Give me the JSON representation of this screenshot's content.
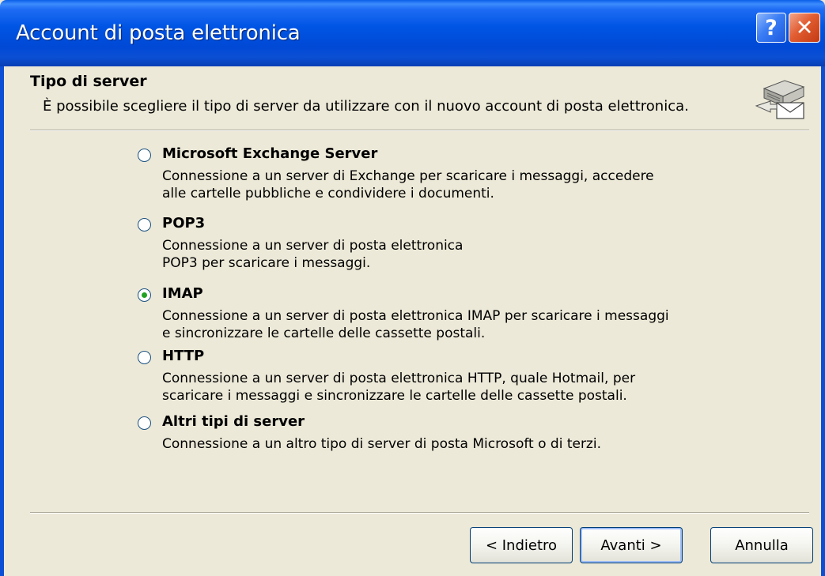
{
  "window": {
    "title": "Account di posta elettronica",
    "help_label": "?",
    "close_label": "✕"
  },
  "header": {
    "title": "Tipo di server",
    "description": "È possibile scegliere il tipo di server da utilizzare con il nuovo account di posta elettronica.",
    "icon": "mail-server-icon"
  },
  "options": [
    {
      "label": "Microsoft Exchange Server",
      "description": "Connessione a un server di Exchange per scaricare i messaggi, accedere\nalle cartelle pubbliche e condividere i documenti.",
      "checked": false
    },
    {
      "label": "POP3",
      "description": "Connessione a un server di posta elettronica\nPOP3 per scaricare i messaggi.",
      "checked": false
    },
    {
      "label": "IMAP",
      "description": "Connessione a un server di posta elettronica IMAP per scaricare i messaggi\ne sincronizzare le cartelle delle cassette postali.",
      "checked": true
    },
    {
      "label": "HTTP",
      "description": "Connessione a un server di posta elettronica HTTP, quale Hotmail, per\nscaricare i messaggi e sincronizzare le cartelle delle cassette postali.",
      "checked": false
    },
    {
      "label": "Altri tipi di server",
      "description": "Connessione a un altro tipo di server di posta Microsoft o di terzi.",
      "checked": false
    }
  ],
  "buttons": {
    "back": "< Indietro",
    "next": "Avanti >",
    "cancel": "Annulla"
  },
  "colors": {
    "titlebar": "#0055e4",
    "dialog_background": "#ece9d8",
    "radio_dot": "#21a121"
  }
}
